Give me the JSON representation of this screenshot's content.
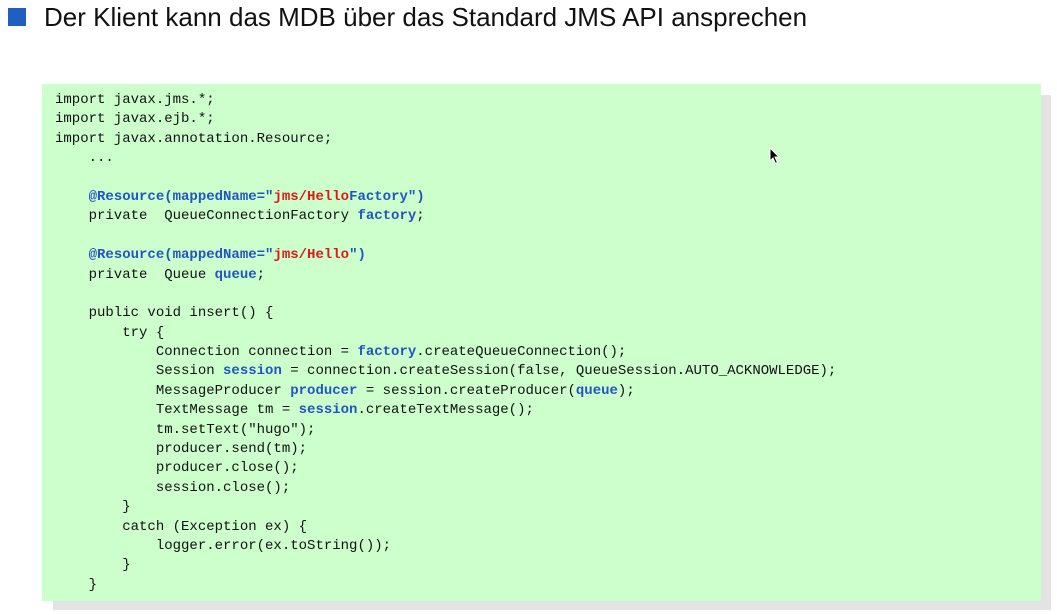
{
  "title": "Der Klient kann das MDB über das Standard JMS API ansprechen",
  "code_lines": [
    [
      {
        "t": "import javax.jms.*;"
      }
    ],
    [
      {
        "t": "import javax.ejb.*;"
      }
    ],
    [
      {
        "t": "import javax.annotation.Resource;"
      }
    ],
    [
      {
        "t": "    ..."
      }
    ],
    [
      {
        "t": ""
      }
    ],
    [
      {
        "t": "    "
      },
      {
        "t": "@Resource(mappedName=\"",
        "c": "kw"
      },
      {
        "t": "jms/Hello",
        "c": "str"
      },
      {
        "t": "Factory\")",
        "c": "kw"
      }
    ],
    [
      {
        "t": "    private  QueueConnectionFactory "
      },
      {
        "t": "factory",
        "c": "kw"
      },
      {
        "t": ";"
      }
    ],
    [
      {
        "t": ""
      }
    ],
    [
      {
        "t": "    "
      },
      {
        "t": "@Resource(mappedName=\"",
        "c": "kw"
      },
      {
        "t": "jms/Hello",
        "c": "str"
      },
      {
        "t": "\")",
        "c": "kw"
      }
    ],
    [
      {
        "t": "    private  Queue "
      },
      {
        "t": "queue",
        "c": "kw"
      },
      {
        "t": ";"
      }
    ],
    [
      {
        "t": ""
      }
    ],
    [
      {
        "t": "    public void insert() {"
      }
    ],
    [
      {
        "t": "        try {"
      }
    ],
    [
      {
        "t": "            Connection connection = "
      },
      {
        "t": "factory",
        "c": "kw"
      },
      {
        "t": ".createQueueConnection();"
      }
    ],
    [
      {
        "t": "            Session "
      },
      {
        "t": "session",
        "c": "kw"
      },
      {
        "t": " = connection.createSession(false, QueueSession.AUTO_ACKNOWLEDGE);"
      }
    ],
    [
      {
        "t": "            MessageProducer "
      },
      {
        "t": "producer",
        "c": "kw"
      },
      {
        "t": " = session.createProducer("
      },
      {
        "t": "queue",
        "c": "kw"
      },
      {
        "t": ");"
      }
    ],
    [
      {
        "t": "            TextMessage tm = "
      },
      {
        "t": "session",
        "c": "kw"
      },
      {
        "t": ".createTextMessage();"
      }
    ],
    [
      {
        "t": "            tm.setText(\"hugo\");"
      }
    ],
    [
      {
        "t": "            producer.send(tm);"
      }
    ],
    [
      {
        "t": "            producer.close();"
      }
    ],
    [
      {
        "t": "            session.close();"
      }
    ],
    [
      {
        "t": "        }"
      }
    ],
    [
      {
        "t": "        catch (Exception ex) {"
      }
    ],
    [
      {
        "t": "            logger.error(ex.toString());"
      }
    ],
    [
      {
        "t": "        }"
      }
    ],
    [
      {
        "t": "    }"
      }
    ]
  ],
  "colors": {
    "bullet": "#1f5fbf",
    "code_background": "#ccffcc",
    "keyword": "#2255c4",
    "string": "#e01818"
  }
}
